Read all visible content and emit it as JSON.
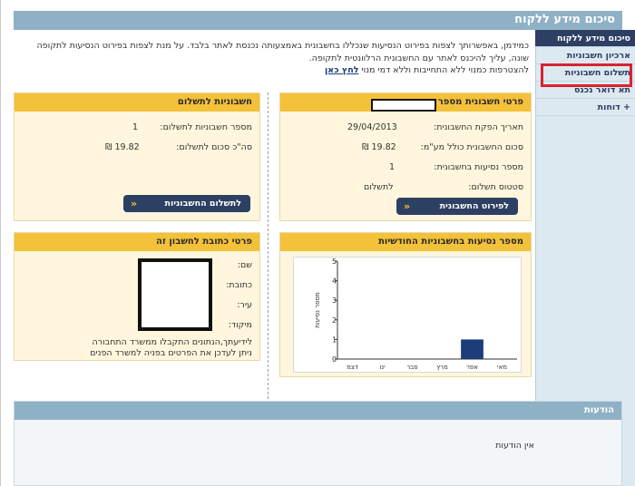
{
  "header": {
    "title": "סיכום מידע ללקוח"
  },
  "sidebar": {
    "items": [
      {
        "label": "סיכום מידע ללקוח"
      },
      {
        "label": "ארכיון חשבוניות"
      },
      {
        "label": "תשלום חשבוניות"
      },
      {
        "label": "תא דואר נכנס"
      },
      {
        "label": "+ דוחות"
      }
    ]
  },
  "intro": {
    "line1": "כמידמן, באפשרותך לצפות בפירוט הנסיעות שנכללו בחשבונית באמצעותה נכנסת לאתר בלבד. על מנת לצפות בפירוט הנסיעות לתקופה",
    "line2": "שונה, עליך להיכנס לאתר עם החשבונית הרלוונטית לתקופה.",
    "line3": "להצטרפות כמנוי ללא התחייבות וללא דמי מנוי",
    "link": "לחץ כאן"
  },
  "account_panel": {
    "title": "פרטי חשבונית מספר",
    "rows": [
      {
        "label": "תאריך הפקת החשבונית:",
        "value": "29/04/2013"
      },
      {
        "label": "סכום החשבונית כולל מע\"מ:",
        "value": "19.82 ₪"
      },
      {
        "label": "מספר נסיעות בחשבונית:",
        "value": "1"
      },
      {
        "label": "סטטוס תשלום:",
        "value": "לתשלום"
      }
    ],
    "button": "לפירוט החשבונית"
  },
  "pay_panel": {
    "title": "חשבוניות לתשלום",
    "rows": [
      {
        "label": "מספר חשבוניות לתשלום:",
        "value": "1"
      },
      {
        "label": "סה\"כ סכום לתשלום:",
        "value": "19.82 ₪"
      }
    ],
    "button": "לתשלום החשבוניות"
  },
  "address_panel": {
    "title": "פרטי כתובת לחשבון זה",
    "labels": {
      "name": "שם:",
      "address": "כתובת:",
      "city": "עיר:",
      "zip": "מיקוד:"
    },
    "note_line1": "לידיעתך,הנתונים התקבלו ממשרד התחבורה",
    "note_line2": "ניתן לעדכן את הפרטים בפניה למשרד הפנים"
  },
  "chart_panel": {
    "title": "מספר נסיעות בחשבוניות החודשיות"
  },
  "chart_data": {
    "type": "bar",
    "categories": [
      "מאי",
      "אפר",
      "מרץ",
      "פבר",
      "ינו",
      "דצמ"
    ],
    "values": [
      0,
      1,
      0,
      0,
      0,
      0
    ],
    "ylabel": "מספר נסיעות",
    "ylim": [
      0,
      5
    ],
    "yticks": [
      "0",
      "1",
      "2",
      "3",
      "4",
      "5"
    ],
    "bar_color": "#1d3c7a"
  },
  "messages": {
    "title": "הודעות",
    "text": "אין הודעות"
  },
  "colors": {
    "accent": "#f3c13a",
    "header": "#8fb1c6",
    "navy": "#2d3f63",
    "highlight": "#d9232e"
  }
}
